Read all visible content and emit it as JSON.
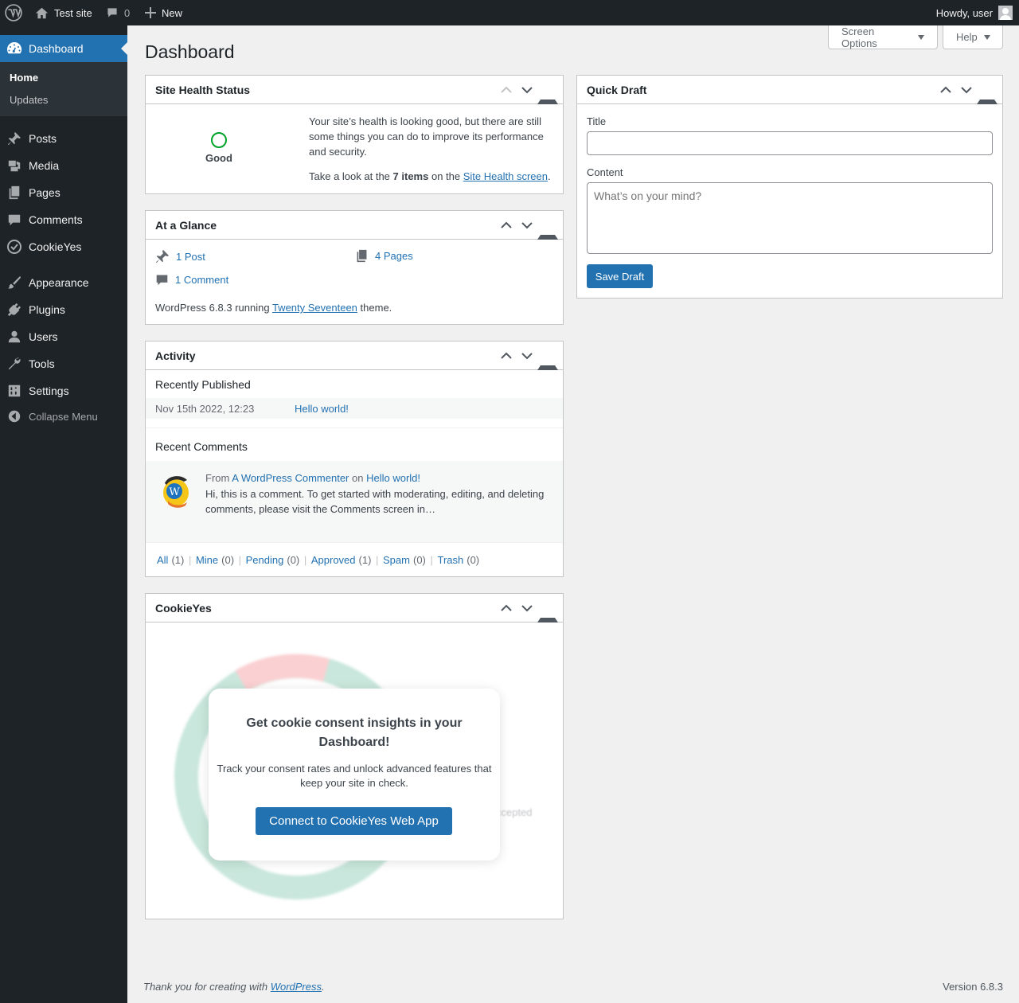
{
  "adminbar": {
    "site_name": "Test site",
    "comments_count": "0",
    "new_label": "New",
    "howdy": "Howdy, user"
  },
  "sidebar": {
    "dashboard": "Dashboard",
    "submenu": [
      "Home",
      "Updates"
    ],
    "items": [
      "Posts",
      "Media",
      "Pages",
      "Comments",
      "CookieYes",
      "Appearance",
      "Plugins",
      "Users",
      "Tools",
      "Settings"
    ],
    "collapse": "Collapse Menu"
  },
  "header": {
    "title": "Dashboard",
    "screen_options": "Screen Options",
    "help": "Help"
  },
  "site_health": {
    "title": "Site Health Status",
    "status": "Good",
    "text": "Your site’s health is looking good, but there are still some things you can do to improve its performance and security.",
    "look_prefix": "Take a look at the",
    "items": "7 items",
    "look_mid": "on the",
    "link": "Site Health screen",
    "period": "."
  },
  "glance": {
    "title": "At a Glance",
    "posts": "1 Post",
    "pages": "4 Pages",
    "comments": "1 Comment",
    "wp_prefix": "WordPress 6.8.3 running",
    "theme": "Twenty Seventeen",
    "wp_suffix": "theme."
  },
  "activity": {
    "title": "Activity",
    "recently_published": "Recently Published",
    "pub_date": "Nov 15th 2022, 12:23",
    "pub_link": "Hello world!",
    "recent_comments": "Recent Comments",
    "from": "From",
    "author": "A WordPress Commenter",
    "on": "on",
    "post": "Hello world!",
    "comment": "Hi, this is a comment. To get started with moderating, editing, and deleting comments, please visit the Comments screen in…",
    "filters": [
      {
        "label": "All",
        "count": "(1)"
      },
      {
        "label": "Mine",
        "count": "(0)"
      },
      {
        "label": "Pending",
        "count": "(0)"
      },
      {
        "label": "Approved",
        "count": "(1)"
      },
      {
        "label": "Spam",
        "count": "(0)"
      },
      {
        "label": "Trash",
        "count": "(0)"
      }
    ]
  },
  "cookieyes": {
    "title": "CookieYes",
    "heading": "Get cookie consent insights in your Dashboard!",
    "text": "Track your consent rates and unlock advanced features that keep your site in check.",
    "button": "Connect to CookieYes Web App",
    "blurred_label": "ccepted"
  },
  "quick_draft": {
    "title": "Quick Draft",
    "title_label": "Title",
    "title_value": "",
    "content_label": "Content",
    "content_placeholder": "What’s on your mind?",
    "save": "Save Draft"
  },
  "footer": {
    "thanks_prefix": "Thank you for creating with",
    "wp_link": "WordPress",
    "thanks_suffix": ".",
    "version": "Version 6.8.3"
  },
  "colors": {
    "accent": "#2271b1",
    "admin_bg": "#1d2327",
    "health_good": "#00a32a"
  }
}
